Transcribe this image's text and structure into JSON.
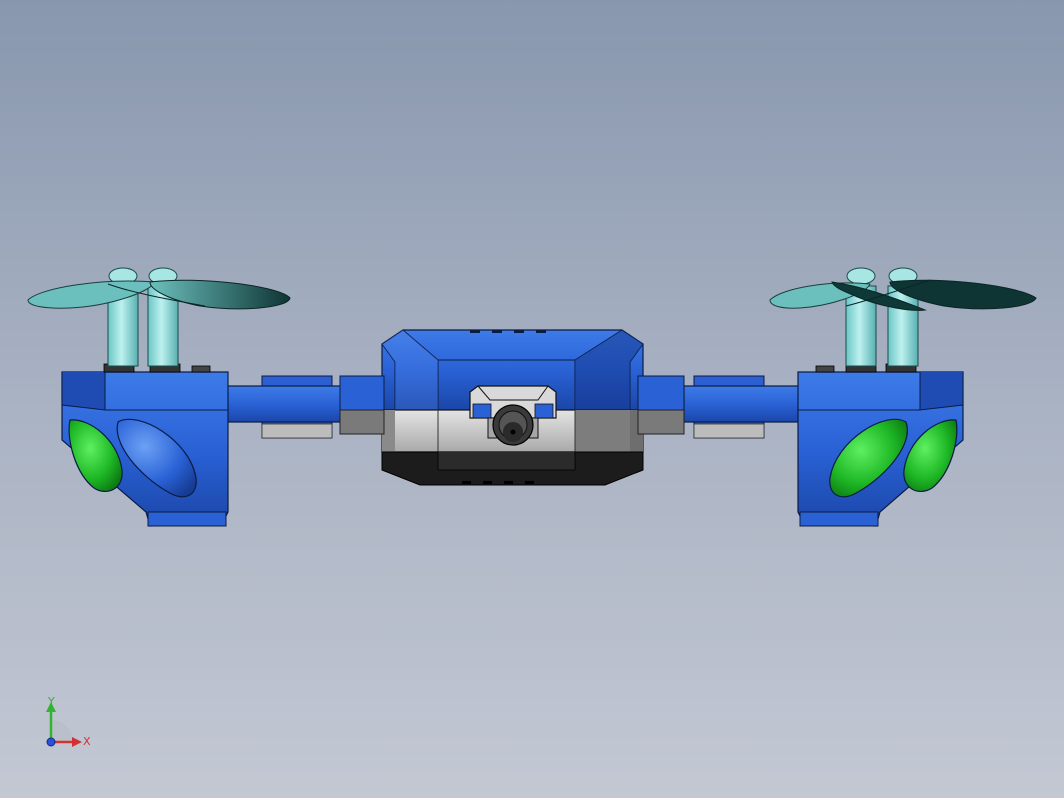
{
  "viewport": {
    "background_top": "#8897ae",
    "background_bottom": "#c3c8d3"
  },
  "model": {
    "body_color": "#2a62d6",
    "body_dark": "#163b92",
    "propeller_color": "#7fd6d4",
    "propeller_blade_color": "#0f3838",
    "light_color": "#22c028",
    "mid_section_color": "#cfcfcf",
    "lower_section_color": "#1c1c1c"
  },
  "triad": {
    "x_label": "X",
    "y_label": "Y",
    "x_color": "#d53030",
    "y_color": "#2fb52f",
    "z_color": "#2c4fd8"
  }
}
